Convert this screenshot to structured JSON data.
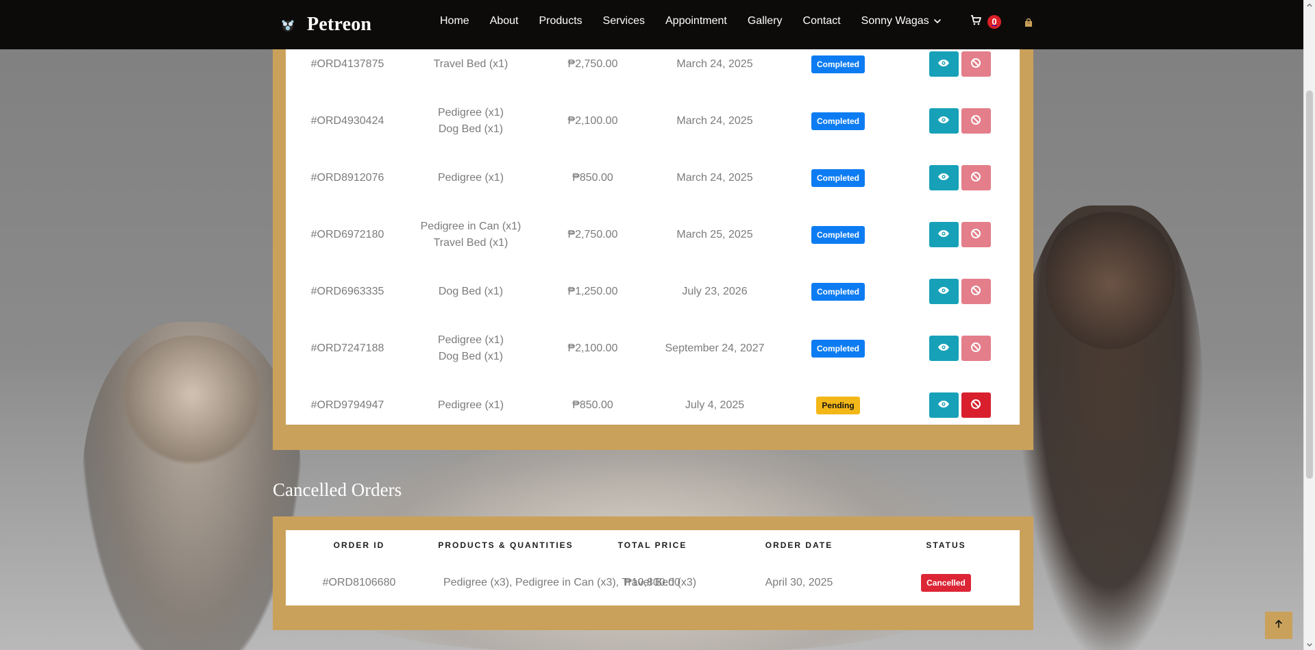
{
  "colors": {
    "header_bg": "#0d0b0a",
    "accent_gold": "#caa15b",
    "completed_blue": "#0d7cf2",
    "pending_yellow": "#f3b718",
    "cancelled_red": "#dc2636",
    "view_teal": "#17a1b8",
    "cancel_pink": "#e37e8a",
    "cancel_red": "#d91f2d",
    "cart_badge_red": "#dc1f26"
  },
  "header": {
    "brand": {
      "name": "Petreon",
      "logo_icon": "paw-logo-icon"
    },
    "nav": {
      "home": "Home",
      "about": "About",
      "products": "Products",
      "services": "Services",
      "appointment": "Appointment",
      "gallery": "Gallery",
      "contact": "Contact",
      "user": "Sonny Wagas",
      "user_menu_icon": "chevron-down-icon"
    },
    "cart": {
      "icon": "cart-icon",
      "count": "0"
    },
    "bag_icon": "shopping-bag-icon"
  },
  "orders": {
    "rows": [
      {
        "order_id": "#ORD4137875",
        "products": [
          "",
          "Travel Bed (x1)"
        ],
        "total": "₱2,750.00",
        "date": "March 24, 2025",
        "status": "Completed"
      },
      {
        "order_id": "#ORD4930424",
        "products": [
          "Pedigree (x1)",
          "Dog Bed (x1)"
        ],
        "total": "₱2,100.00",
        "date": "March 24, 2025",
        "status": "Completed"
      },
      {
        "order_id": "#ORD8912076",
        "products": [
          "Pedigree (x1)"
        ],
        "total": "₱850.00",
        "date": "March 24, 2025",
        "status": "Completed"
      },
      {
        "order_id": "#ORD6972180",
        "products": [
          "Pedigree in Can (x1)",
          "Travel Bed (x1)"
        ],
        "total": "₱2,750.00",
        "date": "March 25, 2025",
        "status": "Completed"
      },
      {
        "order_id": "#ORD6963335",
        "products": [
          "Dog Bed (x1)"
        ],
        "total": "₱1,250.00",
        "date": "July 23, 2026",
        "status": "Completed"
      },
      {
        "order_id": "#ORD7247188",
        "products": [
          "Pedigree (x1)",
          "Dog Bed (x1)"
        ],
        "total": "₱2,100.00",
        "date": "September 24, 2027",
        "status": "Completed"
      },
      {
        "order_id": "#ORD9794947",
        "products": [
          "Pedigree (x1)"
        ],
        "total": "₱850.00",
        "date": "July 4, 2025",
        "status": "Pending"
      }
    ],
    "action_icons": {
      "view": "eye-icon",
      "cancel": "ban-icon"
    }
  },
  "cancelled": {
    "title": "Cancelled Orders",
    "columns": [
      "ORDER ID",
      "PRODUCTS & QUANTITIES",
      "TOTAL PRICE",
      "ORDER DATE",
      "STATUS"
    ],
    "row": {
      "order_id": "#ORD8106680",
      "products": "Pedigree (x3), Pedigree in Can (x3), Travel Bed (x3)",
      "total": "₱10,800.00",
      "date": "April 30, 2025",
      "status": "Cancelled"
    }
  },
  "ui": {
    "back_to_top_icon": "arrow-up-icon",
    "scrollbar_up_icon": "scroll-up-icon",
    "scrollbar_down_icon": "scroll-down-icon"
  }
}
